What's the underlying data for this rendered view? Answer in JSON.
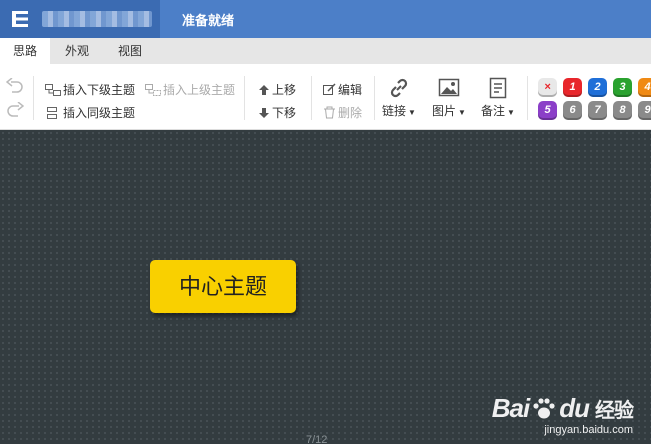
{
  "titlebar": {
    "status": "准备就绪"
  },
  "tabs": [
    {
      "label": "思路",
      "active": true
    },
    {
      "label": "外观",
      "active": false
    },
    {
      "label": "视图",
      "active": false
    }
  ],
  "toolbar": {
    "insert_child": "插入下级主题",
    "insert_parent": "插入上级主题",
    "insert_sibling": "插入同级主题",
    "move_up": "上移",
    "move_down": "下移",
    "edit": "编辑",
    "delete": "删除",
    "link": "链接",
    "image": "图片",
    "note": "备注"
  },
  "priorities": [
    {
      "label": "×",
      "color": "#e8e8e8"
    },
    {
      "label": "1",
      "color": "#e8262b"
    },
    {
      "label": "2",
      "color": "#1f6fd8"
    },
    {
      "label": "3",
      "color": "#2aa22f"
    },
    {
      "label": "4",
      "color": "#f08a14"
    },
    {
      "label": "5",
      "color": "#8b3fc8"
    },
    {
      "label": "6",
      "color": "#8a8a8a"
    },
    {
      "label": "7",
      "color": "#8a8a8a"
    },
    {
      "label": "8",
      "color": "#8a8a8a"
    },
    {
      "label": "9",
      "color": "#8a8a8a"
    }
  ],
  "canvas": {
    "center_topic": "中心主题",
    "pager": "7/12",
    "background": "#333c40",
    "node_color": "#f9d000"
  },
  "watermark": {
    "brand_left": "Bai",
    "brand_right": "du",
    "brand_cn": "经验",
    "url": "jingyan.baidu.com"
  }
}
